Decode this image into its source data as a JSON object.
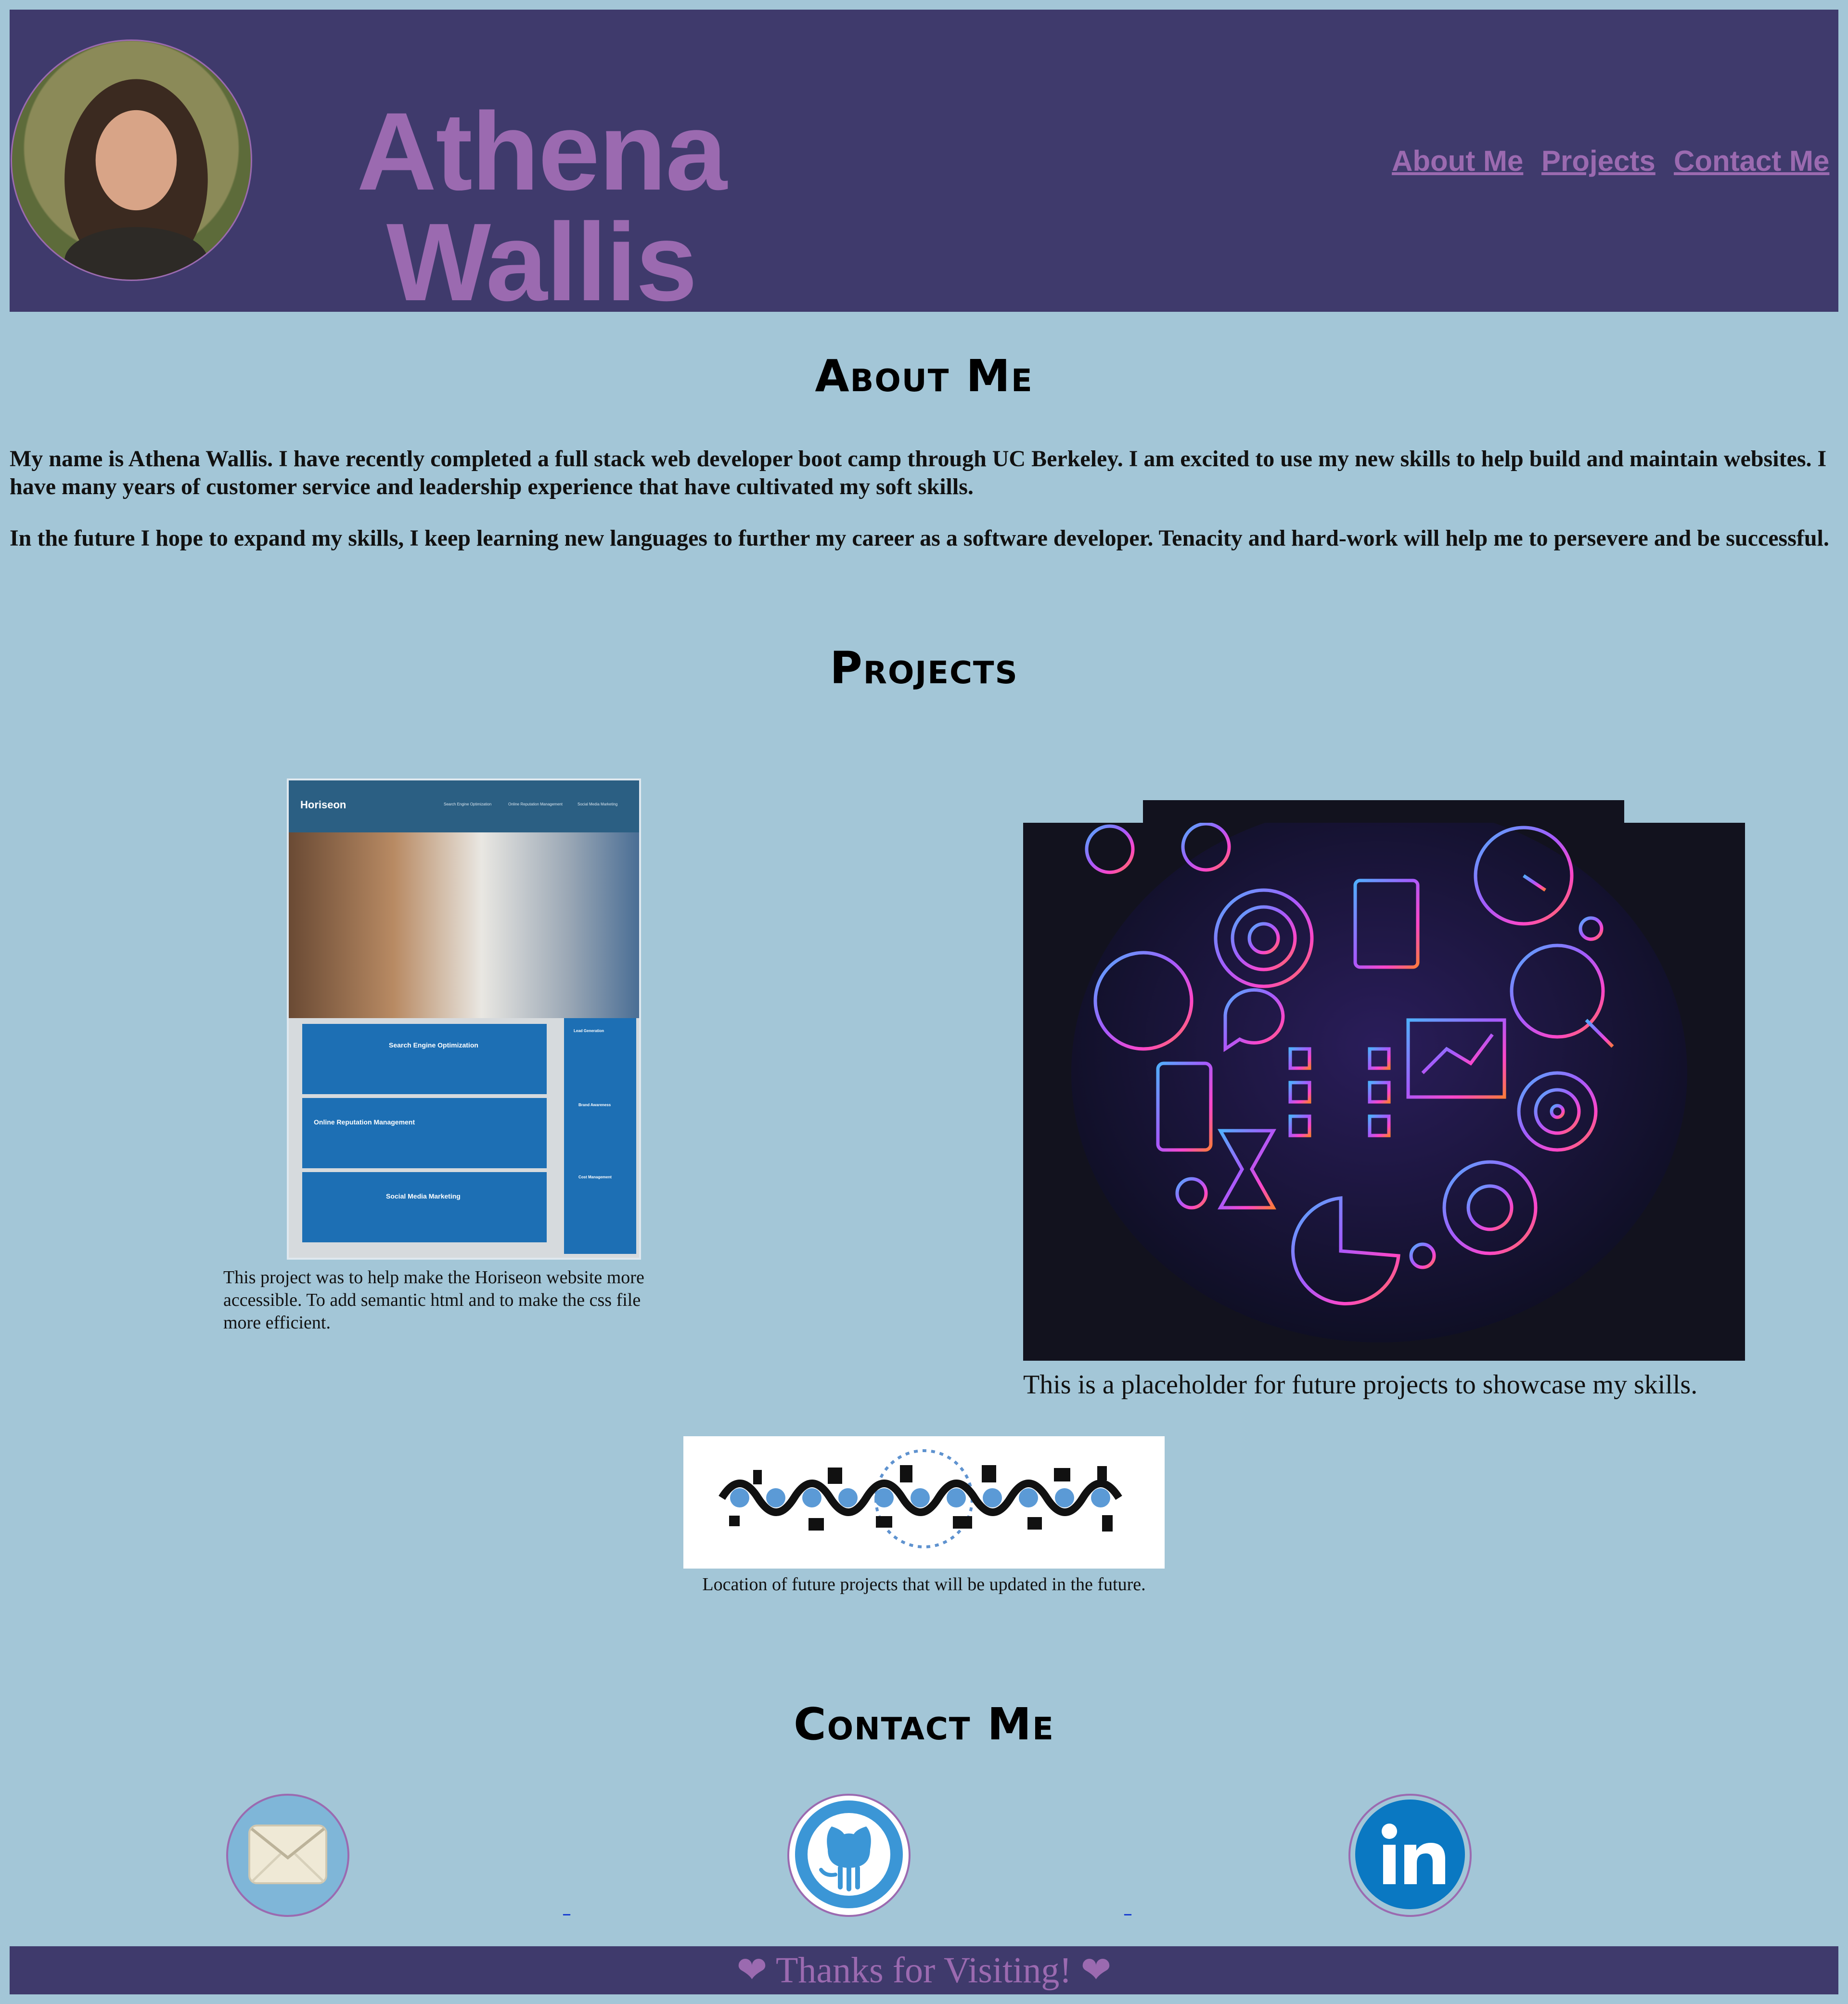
{
  "header": {
    "name": "Athena Wallis",
    "nav": [
      {
        "label": "About Me"
      },
      {
        "label": "Projects"
      },
      {
        "label": "Contact Me"
      }
    ]
  },
  "about": {
    "title": "About Me",
    "paragraphs": [
      "My name is Athena Wallis. I have recently completed a full stack web developer boot camp through UC Berkeley. I am excited to use my new skills to help build and maintain websites. I have many years of customer service and leadership experience that have cultivated my soft skills.",
      "In the future I hope to expand my skills, I keep learning new languages to further my career as a software developer. Tenacity and hard-work will help me to persevere and be successful."
    ]
  },
  "projects": {
    "title": "Projects",
    "horiseon": {
      "logo": "Horiseon",
      "nav": [
        "Search Engine Optimization",
        "Online Reputation Management",
        "Social Media Marketing"
      ],
      "cards": [
        "Search Engine Optimization",
        "Online Reputation Management",
        "Social Media Marketing"
      ],
      "side": [
        "Lead Generation",
        "Brand Awareness",
        "Cost Management"
      ],
      "caption": "This project was to help make the Horiseon website more accessible. To add semantic html and to make the css file more efficient."
    },
    "placeholder_caption": "This is a placeholder for future projects to showcase my skills.",
    "timeline_caption": "Location of future projects that will be updated in the future."
  },
  "contact": {
    "title": "Contact Me",
    "icons": [
      "envelope-icon",
      "github-octocat-icon",
      "linkedin-icon"
    ],
    "link_text": "_"
  },
  "footer": {
    "text": "Thanks for Visiting!",
    "heart": "❤"
  },
  "colors": {
    "page_bg": "#a3c6d7",
    "header_bg": "#3f3a6c",
    "accent": "#9b6ab0"
  }
}
